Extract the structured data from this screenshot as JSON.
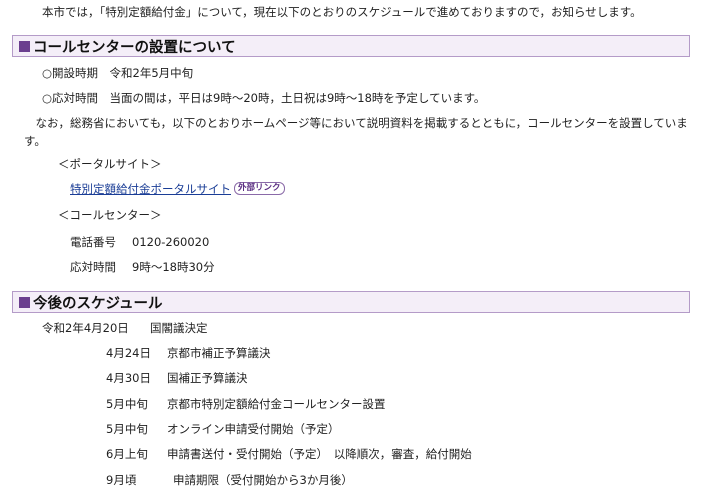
{
  "intro": "本市では，「特別定額給付金」について，現在以下のとおりのスケジュールで進めておりますので，お知らせします。",
  "section1": {
    "title": "コールセンターの設置について",
    "opening": "○開設時期　令和2年5月中旬",
    "hours": "○応対時間　当面の間は，平日は9時～20時，土日祝は9時～18時を予定しています。",
    "paragraph": "　なお，総務省においても，以下のとおりホームページ等において説明資料を掲載するとともに，コールセンターを設置しています。",
    "portal_heading": "＜ポータルサイト＞",
    "portal_link": "特別定額給付金ポータルサイト",
    "external_badge": "外部リンク",
    "callcenter_heading": "＜コールセンター＞",
    "phone_label": "電話番号",
    "phone_value": "0120-260020",
    "hours_label": "応対時間",
    "hours_value": "9時～18時30分"
  },
  "section2": {
    "title": "今後のスケジュール",
    "first_date": "令和2年4月20日",
    "first_event": "国閣議決定",
    "items": [
      {
        "date": "4月24日",
        "event": "京都市補正予算議決"
      },
      {
        "date": "4月30日",
        "event": "国補正予算議決"
      },
      {
        "date": "5月中旬",
        "event": "京都市特別定額給付金コールセンター設置"
      },
      {
        "date": "5月中旬",
        "event": "オンライン申請受付開始（予定）"
      },
      {
        "date": "6月上旬",
        "event": "申請書送付・受付開始（予定）　以降順次，審査，給付開始"
      },
      {
        "date": "9月頃",
        "event": "申請期限（受付開始から3か月後）"
      }
    ]
  }
}
